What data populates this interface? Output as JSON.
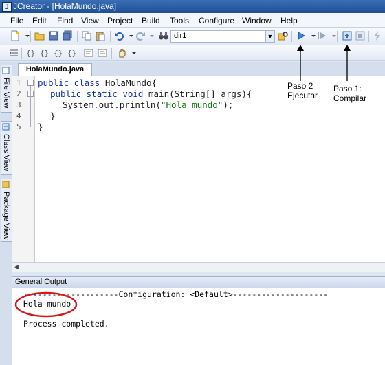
{
  "window": {
    "title": "JCreator - [HolaMundo.java]",
    "app_icon": "J"
  },
  "menu": [
    "File",
    "Edit",
    "Find",
    "View",
    "Project",
    "Build",
    "Tools",
    "Configure",
    "Window",
    "Help"
  ],
  "toolbar": {
    "config_combo": "dir1"
  },
  "side_tabs": [
    "File View",
    "Class View",
    "Package View"
  ],
  "editor": {
    "tab": "HolaMundo.java",
    "line_numbers": [
      "1",
      "2",
      "3",
      "4",
      "5"
    ],
    "lines": [
      {
        "kw": "public class ",
        "rest": "HolaMundo{"
      },
      {
        "kw": "public static void ",
        "rest": "main(String[] args){"
      },
      {
        "pre": "System.out.println(",
        "str": "\"Hola mundo\"",
        "post": ");"
      },
      {
        "rest": "}"
      },
      {
        "rest": "}"
      }
    ]
  },
  "output": {
    "title": "General Output",
    "lines": [
      "--------------------Configuration: <Default>--------------------",
      "Hola mundo",
      "",
      "Process completed."
    ]
  },
  "annotations": {
    "step2": [
      "Paso 2",
      "Ejecutar"
    ],
    "step1": [
      "Paso 1:",
      "Compilar"
    ]
  },
  "colors": {
    "titlebar": "#2b5ea4",
    "keyword": "#0b2fb3",
    "string": "#117711",
    "circle": "#d81818"
  }
}
